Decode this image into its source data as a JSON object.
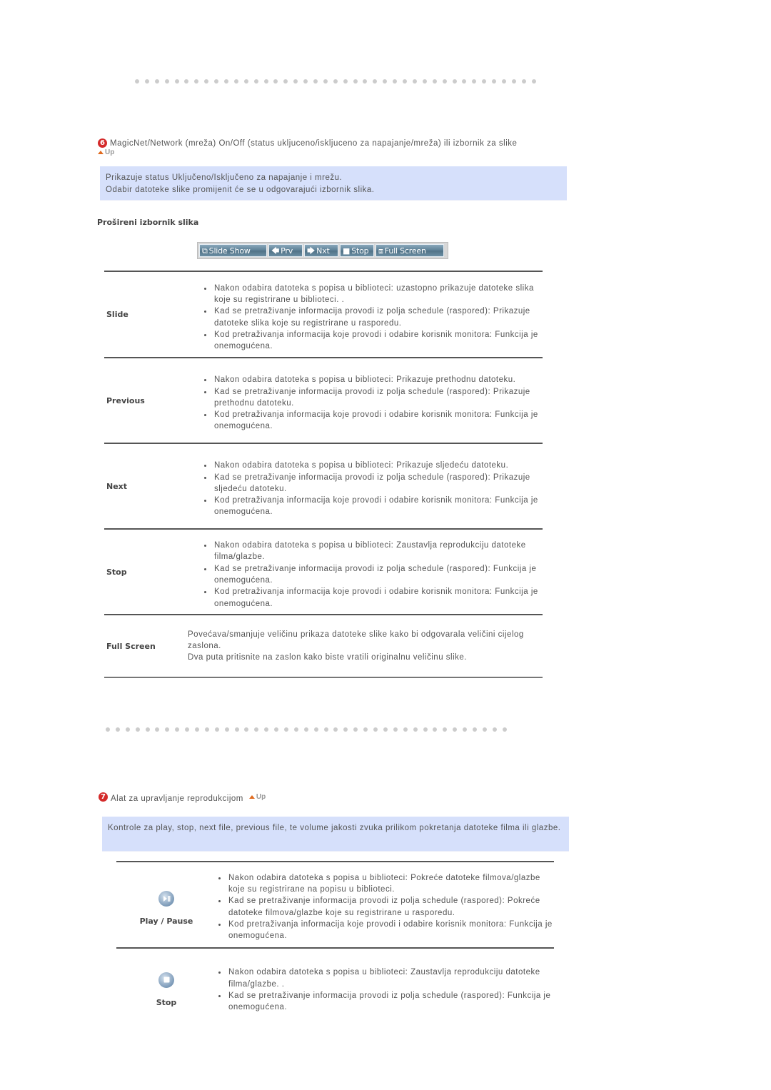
{
  "section6": {
    "number": "6",
    "title": "MagicNet/Network (mreža) On/Off (status ukljuceno/iskljuceno za napajanje/mreža) ili izbornik za slike",
    "up_label": "Up",
    "info_lines": [
      "Prikazuje status Uključeno/Isključeno za napajanje i mrežu.",
      "Odabir datoteke slike promijenit će se u odgovarajući izbornik slika."
    ],
    "subheading": "Prošireni izbornik slika",
    "toolbar": {
      "buttons": [
        {
          "label": "Slide Show",
          "icon": "slideshow-icon"
        },
        {
          "label": "Prv",
          "icon": "arrow-left-icon"
        },
        {
          "label": "Nxt",
          "icon": "arrow-right-icon"
        },
        {
          "label": "Stop",
          "icon": "stop-square-icon"
        },
        {
          "label": "Full Screen",
          "icon": "fullscreen-icon"
        }
      ]
    },
    "rows": [
      {
        "label": "Slide",
        "bullets": [
          "Nakon odabira datoteka s popisa u biblioteci: uzastopno prikazuje datoteke slika koje su registrirane u biblioteci. .",
          "Kad se pretraživanje informacija provodi iz polja schedule (raspored): Prikazuje datoteke slika koje su registrirane u rasporedu.",
          "Kod pretraživanja informacija koje provodi i odabire korisnik monitora: Funkcija je onemogućena."
        ]
      },
      {
        "label": "Previous",
        "bullets": [
          "Nakon odabira datoteka s popisa u biblioteci: Prikazuje prethodnu datoteku.",
          "Kad se pretraživanje informacija provodi iz polja schedule (raspored): Prikazuje prethodnu datoteku.",
          "Kod pretraživanja informacija koje provodi i odabire korisnik monitora: Funkcija je onemogućena."
        ]
      },
      {
        "label": "Next",
        "bullets": [
          "Nakon odabira datoteka s popisa u biblioteci: Prikazuje sljedeću datoteku.",
          "Kad se pretraživanje informacija provodi iz polja schedule (raspored): Prikazuje sljedeću datoteku.",
          "Kod pretraživanja informacija koje provodi i odabire korisnik monitora: Funkcija je onemogućena."
        ]
      },
      {
        "label": "Stop",
        "bullets": [
          "Nakon odabira datoteka s popisa u biblioteci: Zaustavlja reprodukciju datoteke filma/glazbe.",
          "Kad se pretraživanje informacija provodi iz polja schedule (raspored): Funkcija je onemogućena.",
          "Kod pretraživanja informacija koje provodi i odabire korisnik monitora: Funkcija je onemogućena."
        ]
      },
      {
        "label": "Full Screen",
        "paragraphs": [
          "Povećava/smanjuje veličinu prikaza datoteke slike kako bi odgovarala veličini cijelog zaslona.",
          "Dva puta pritisnite na zaslon kako biste vratili originalnu veličinu slike."
        ]
      }
    ]
  },
  "section7": {
    "number": "7",
    "title": "Alat za upravljanje reprodukcijom",
    "up_label": "Up",
    "info_lines": [
      "Kontrole za play, stop, next file, previous file, te volume jakosti zvuka prilikom pokretanja datoteke filma ili glazbe."
    ],
    "rows": [
      {
        "label": "Play / Pause",
        "icon": "play-pause-icon",
        "bullets": [
          "Nakon odabira datoteka s popisa u biblioteci: Pokreće datoteke filmova/glazbe koje su registrirane na popisu u biblioteci.",
          "Kad se pretraživanje informacija provodi iz polja schedule (raspored): Pokreće datoteke filmova/glazbe koje su registrirane u rasporedu.",
          "Kod pretraživanja informacija koje provodi i odabire korisnik monitora: Funkcija je onemogućena."
        ]
      },
      {
        "label": "Stop",
        "icon": "stop-icon",
        "bullets": [
          "Nakon odabira datoteka s popisa u biblioteci: Zaustavlja reprodukciju datoteke filma/glazbe. .",
          "Kad se pretraživanje informacija provodi iz polja schedule (raspored): Funkcija je onemogućena."
        ]
      }
    ]
  }
}
